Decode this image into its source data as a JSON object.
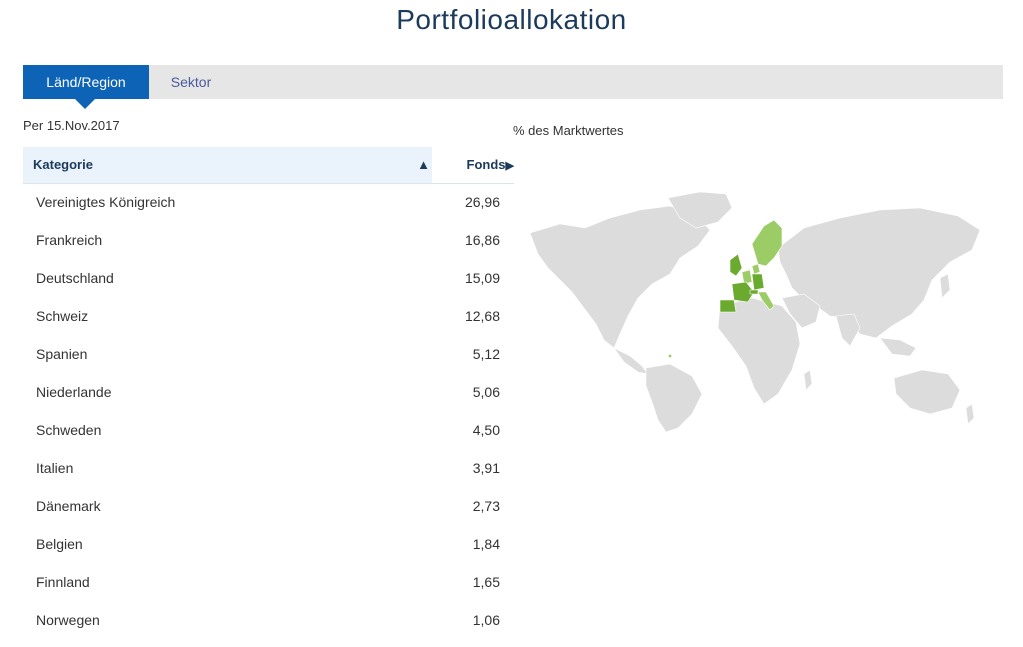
{
  "title": "Portfolioallokation",
  "tabs": [
    {
      "label": "Länd/Region",
      "active": true
    },
    {
      "label": "Sektor",
      "active": false
    }
  ],
  "as_of": "Per 15.Nov.2017",
  "map_caption": "% des Marktwertes",
  "table": {
    "col_category": "Kategorie",
    "col_category_sort": "▲",
    "col_value": "Fonds",
    "col_value_sort": "▶",
    "rows": [
      {
        "name": "Vereinigtes Königreich",
        "value": "26,96"
      },
      {
        "name": "Frankreich",
        "value": "16,86"
      },
      {
        "name": "Deutschland",
        "value": "15,09"
      },
      {
        "name": "Schweiz",
        "value": "12,68"
      },
      {
        "name": "Spanien",
        "value": "5,12"
      },
      {
        "name": "Niederlande",
        "value": "5,06"
      },
      {
        "name": "Schweden",
        "value": "4,50"
      },
      {
        "name": "Italien",
        "value": "3,91"
      },
      {
        "name": "Dänemark",
        "value": "2,73"
      },
      {
        "name": "Belgien",
        "value": "1,84"
      },
      {
        "name": "Finnland",
        "value": "1,65"
      },
      {
        "name": "Norwegen",
        "value": "1,06"
      }
    ]
  },
  "colors": {
    "accent": "#0d63b6",
    "map_land": "#dcdcdc",
    "map_highlight_strong": "#6aaa2e",
    "map_highlight": "#9ccc65"
  }
}
